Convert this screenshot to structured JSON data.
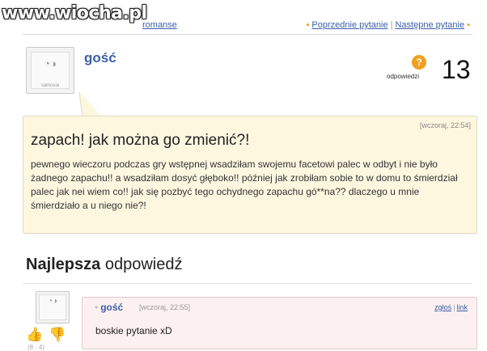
{
  "watermark": "www.wiocha.pl",
  "breadcrumb": {
    "label": "romanse"
  },
  "nav": {
    "prev_label": "Poprzednie pytanie",
    "next_label": "Następne pytanie"
  },
  "asker": {
    "name": "gość",
    "avatar_caption": "samosia"
  },
  "answers": {
    "label": "odpowiedzi",
    "count": "13"
  },
  "question": {
    "time": "[wczoraj, 22:54]",
    "title": "zapach! jak można go zmienić?!",
    "body": "pewnego wieczoru podczas gry wstępnej wsadziłam swojemu facetowi palec w odbyt i nie było żadnego zapachu!! a wsadziłam dosyć głęboko!! później jak zrobiłam sobie to w domu to śmierdział palec jak nei wiem co!! jak się pozbyć tego ochydnego zapachu gó**na?? dlaczego u mnie śmierdziało a u niego nie?!"
  },
  "best_answer": {
    "heading_bold": "Najlepsza",
    "heading_rest": " odpowiedź",
    "author": "gość",
    "time": "[wczoraj, 22:55]",
    "report_label": "zgłoś",
    "link_label": "link",
    "text": "boskie pytanie xD",
    "votes": "(8 : 4)"
  },
  "colors": {
    "link": "#3b5fa8",
    "question_bg": "#fdf7e0",
    "answer_bg": "#fcf0f0",
    "accent": "#f0a020"
  }
}
